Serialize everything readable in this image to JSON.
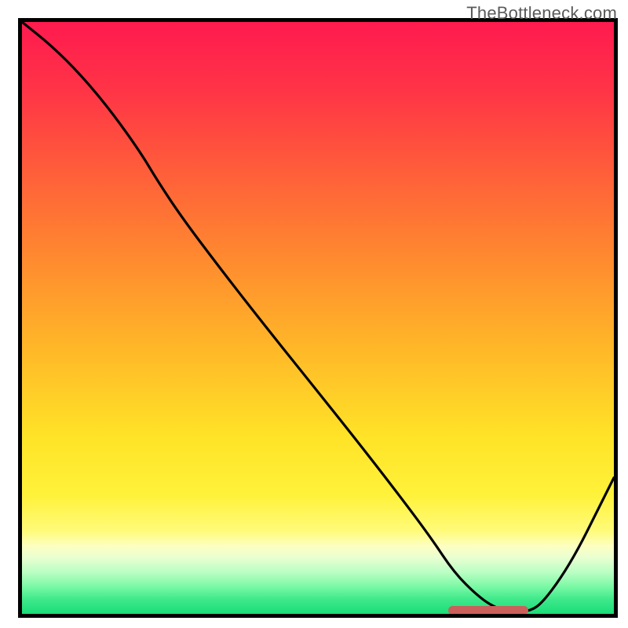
{
  "watermark": "TheBottleneck.com",
  "colors": {
    "frame_border": "#000000",
    "curve": "#000000",
    "marker": "#cb5f5b",
    "gradient_stops": [
      {
        "offset": 0.0,
        "color": "#ff1a4f"
      },
      {
        "offset": 0.12,
        "color": "#ff3546"
      },
      {
        "offset": 0.25,
        "color": "#ff5d3a"
      },
      {
        "offset": 0.4,
        "color": "#ff8a2f"
      },
      {
        "offset": 0.55,
        "color": "#ffb728"
      },
      {
        "offset": 0.7,
        "color": "#ffe327"
      },
      {
        "offset": 0.8,
        "color": "#fff23a"
      },
      {
        "offset": 0.86,
        "color": "#fffb7a"
      },
      {
        "offset": 0.885,
        "color": "#fdffc0"
      },
      {
        "offset": 0.905,
        "color": "#e9ffd2"
      },
      {
        "offset": 0.93,
        "color": "#b9fec3"
      },
      {
        "offset": 0.955,
        "color": "#78f8a4"
      },
      {
        "offset": 0.975,
        "color": "#3fe98b"
      },
      {
        "offset": 1.0,
        "color": "#19dd78"
      }
    ]
  },
  "chart_data": {
    "type": "line",
    "title": "",
    "xlabel": "",
    "ylabel": "",
    "xlim": [
      0,
      100
    ],
    "ylim": [
      0,
      100
    ],
    "marker": {
      "x_start": 72,
      "x_end": 85.5,
      "y": 0.5
    },
    "series": [
      {
        "name": "curve",
        "x": [
          0,
          5,
          10,
          15,
          20,
          23,
          27,
          33,
          40,
          48,
          56,
          63,
          69,
          73,
          77,
          80,
          83,
          86,
          88,
          91,
          94,
          97,
          100
        ],
        "y": [
          100,
          96,
          91,
          85,
          78,
          73,
          67,
          59,
          50,
          40,
          30,
          21,
          13,
          7,
          3,
          1,
          0.3,
          0.5,
          2,
          6,
          11,
          17,
          23
        ]
      }
    ]
  }
}
